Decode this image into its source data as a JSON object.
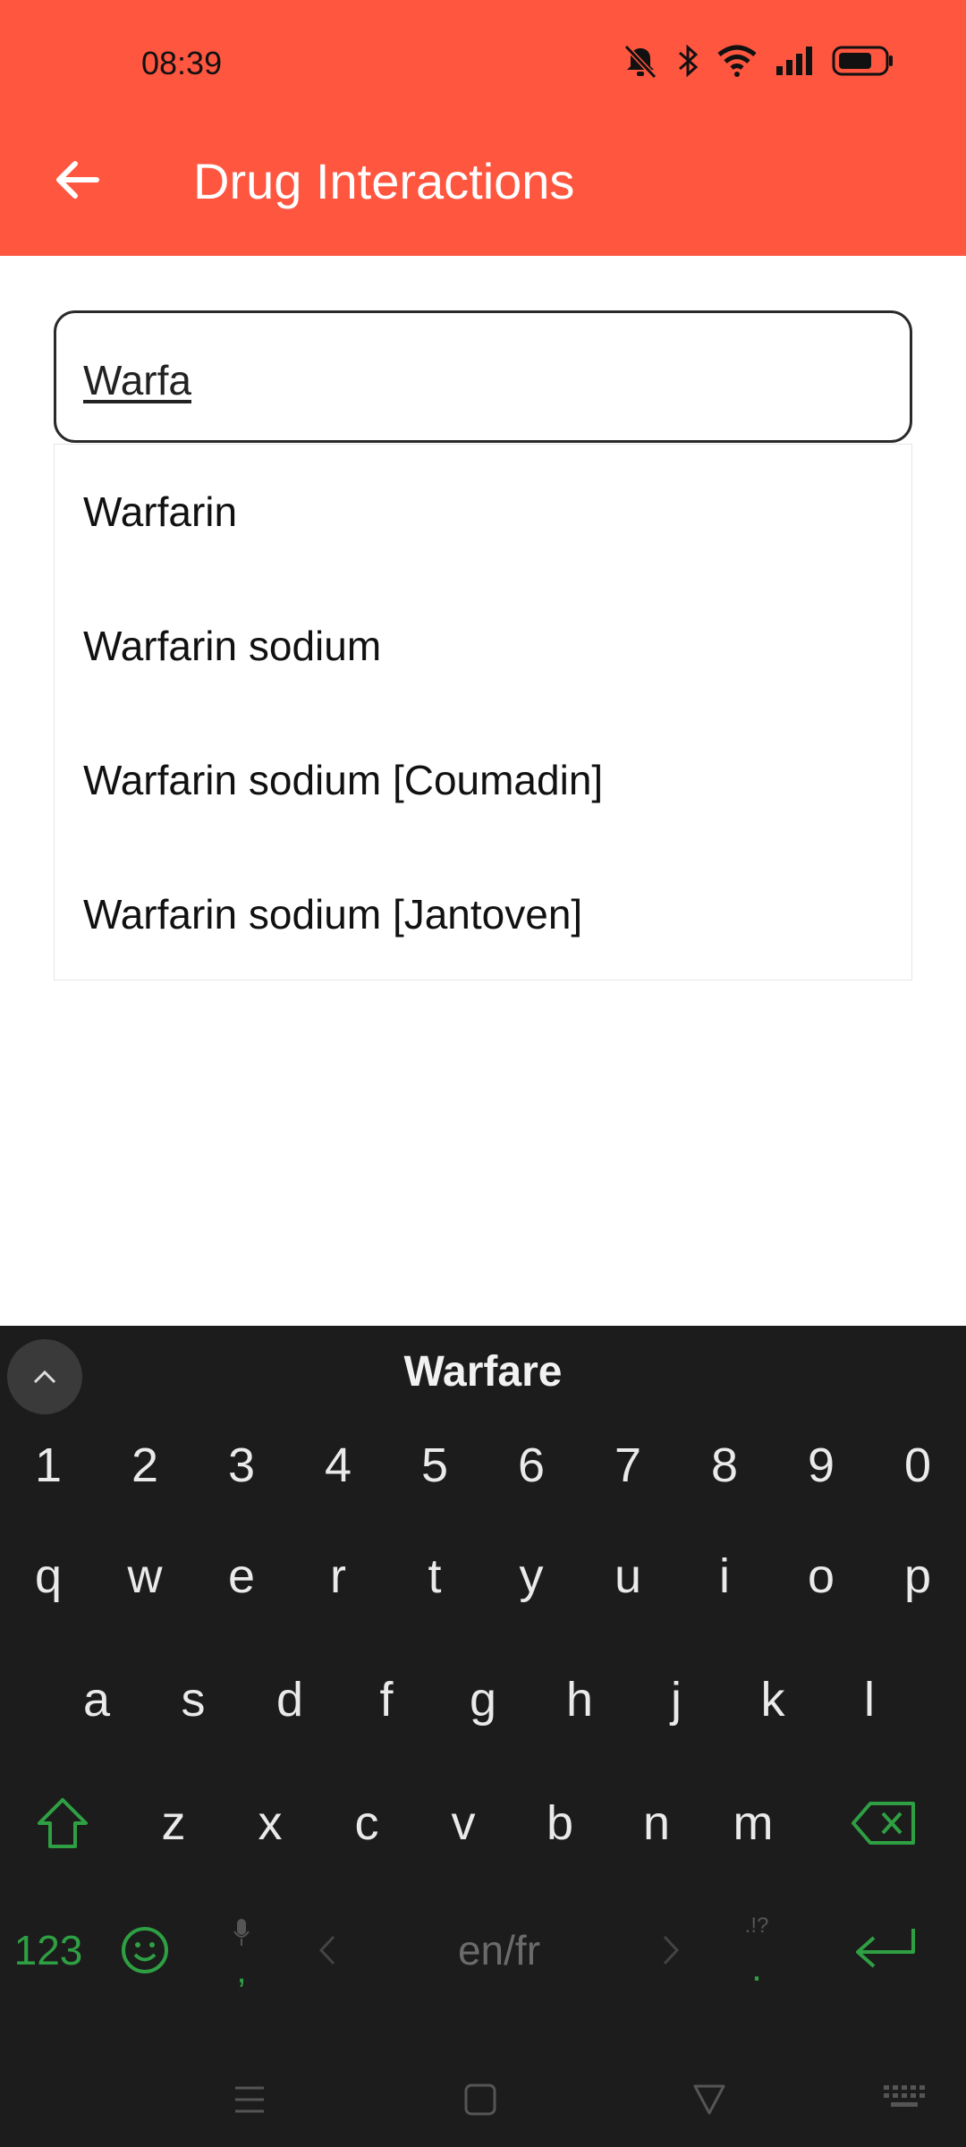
{
  "status_bar": {
    "time": "08:39"
  },
  "app_bar": {
    "title": "Drug Interactions",
    "back_icon": "arrow-left-icon"
  },
  "search": {
    "value": "Warfa"
  },
  "suggestions": [
    "Warfarin",
    "Warfarin sodium",
    "Warfarin sodium [Coumadin]",
    "Warfarin sodium [Jantoven]"
  ],
  "keyboard": {
    "suggestion": "Warfare",
    "numbers": [
      "1",
      "2",
      "3",
      "4",
      "5",
      "6",
      "7",
      "8",
      "9",
      "0"
    ],
    "row1": [
      "q",
      "w",
      "e",
      "r",
      "t",
      "y",
      "u",
      "i",
      "o",
      "p"
    ],
    "row2": [
      "a",
      "s",
      "d",
      "f",
      "g",
      "h",
      "j",
      "k",
      "l"
    ],
    "row3": [
      "z",
      "x",
      "c",
      "v",
      "b",
      "n",
      "m"
    ],
    "symbols_label": "123",
    "comma_label": ",",
    "period_label": ".",
    "punct_hint": ".!?",
    "space_label": "en/fr"
  },
  "colors": {
    "app_bar": "#FF5640",
    "keyboard_bg": "#1c1c1c",
    "keyboard_accent": "#2ea043"
  }
}
